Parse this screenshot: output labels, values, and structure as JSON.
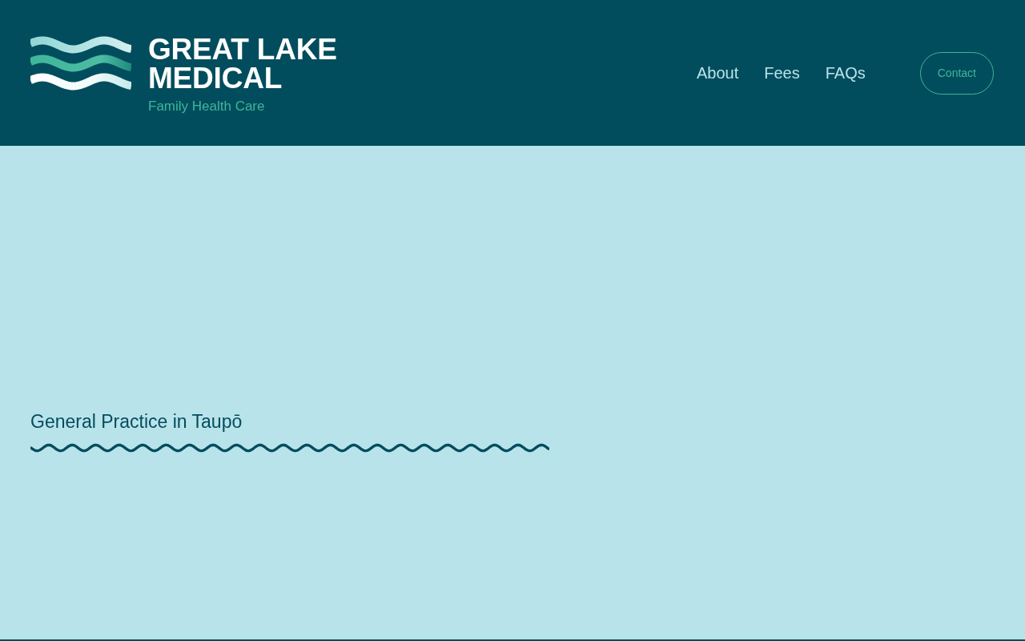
{
  "header": {
    "logo": {
      "title_lines": [
        "GREAT LAKE",
        "MEDICAL"
      ],
      "tagline": "Family Health Care"
    },
    "nav": [
      {
        "label": "About"
      },
      {
        "label": "Fees"
      },
      {
        "label": "FAQs"
      }
    ],
    "contact_button": {
      "label": "Contact"
    }
  },
  "hero": {
    "heading": "General Practice in Taupō"
  }
}
